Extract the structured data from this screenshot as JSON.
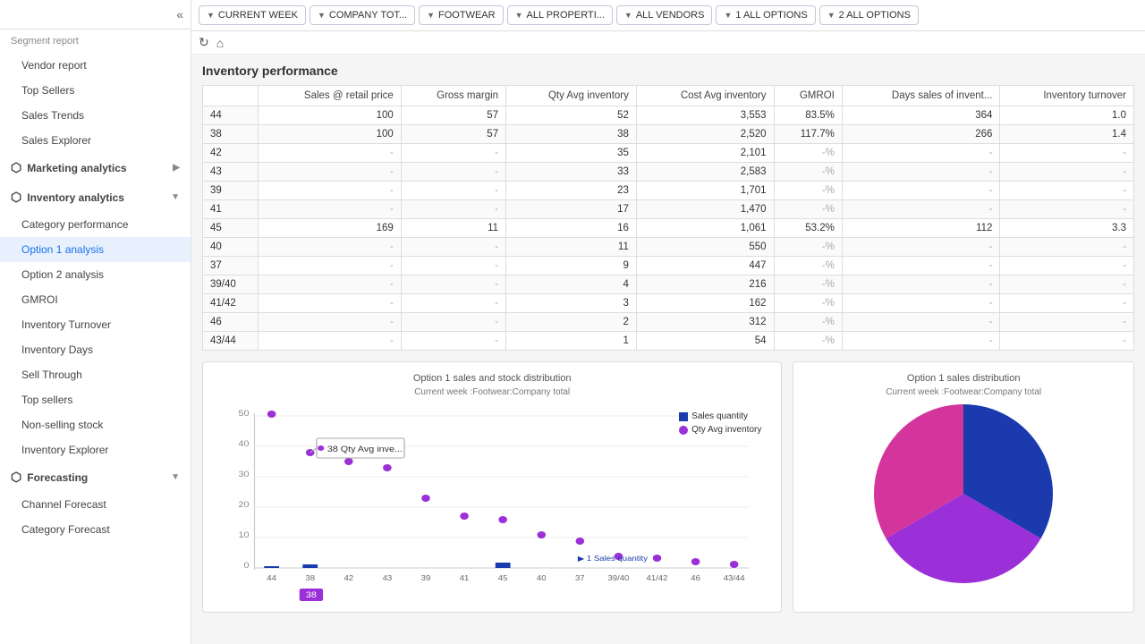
{
  "sidebar": {
    "collapse_icon": "«",
    "sections": [
      {
        "id": "marketing",
        "icon": "📊",
        "label": "Marketing analytics",
        "expanded": true,
        "items": []
      },
      {
        "id": "inventory",
        "icon": "📦",
        "label": "Inventory analytics",
        "expanded": true,
        "items": [
          {
            "id": "category-performance",
            "label": "Category performance",
            "active": false
          },
          {
            "id": "option1-analysis",
            "label": "Option 1 analysis",
            "active": true
          },
          {
            "id": "option2-analysis",
            "label": "Option 2 analysis",
            "active": false
          },
          {
            "id": "gmroi",
            "label": "GMROI",
            "active": false
          },
          {
            "id": "inventory-turnover",
            "label": "Inventory Turnover",
            "active": false
          },
          {
            "id": "inventory-days",
            "label": "Inventory Days",
            "active": false
          },
          {
            "id": "sell-through",
            "label": "Sell Through",
            "active": false
          },
          {
            "id": "top-sellers",
            "label": "Top sellers",
            "active": false
          },
          {
            "id": "non-selling-stock",
            "label": "Non-selling stock",
            "active": false
          },
          {
            "id": "inventory-explorer",
            "label": "Inventory Explorer",
            "active": false
          }
        ]
      },
      {
        "id": "forecasting",
        "icon": "📈",
        "label": "Forecasting",
        "expanded": true,
        "items": [
          {
            "id": "channel-forecast",
            "label": "Channel Forecast",
            "active": false
          },
          {
            "id": "category-forecast",
            "label": "Category Forecast",
            "active": false
          }
        ]
      }
    ]
  },
  "filters": [
    {
      "id": "week",
      "label": "CURRENT WEEK"
    },
    {
      "id": "company",
      "label": "COMPANY TOT..."
    },
    {
      "id": "footwear",
      "label": "FOOTWEAR"
    },
    {
      "id": "properties",
      "label": "ALL PROPERTI..."
    },
    {
      "id": "vendors",
      "label": "ALL VENDORS"
    },
    {
      "id": "options1",
      "label": "1 ALL OPTIONS"
    },
    {
      "id": "options2",
      "label": "2 ALL OPTIONS"
    }
  ],
  "page_title": "Inventory performance",
  "table": {
    "headers": [
      "",
      "Sales @ retail price",
      "Gross margin",
      "Qty Avg inventory",
      "Cost Avg inventory",
      "GMROI",
      "Days sales of invent...",
      "Inventory turnover"
    ],
    "rows": [
      {
        "label": "44",
        "sales": "100",
        "gross": "57",
        "qty": "52",
        "cost": "3,553",
        "gmroi": "83.5%",
        "days": "364",
        "turnover": "1.0"
      },
      {
        "label": "38",
        "sales": "100",
        "gross": "57",
        "qty": "38",
        "cost": "2,520",
        "gmroi": "117.7%",
        "days": "266",
        "turnover": "1.4"
      },
      {
        "label": "42",
        "sales": "-",
        "gross": "-",
        "qty": "35",
        "cost": "2,101",
        "gmroi": "-%",
        "days": "-",
        "turnover": "-"
      },
      {
        "label": "43",
        "sales": "-",
        "gross": "-",
        "qty": "33",
        "cost": "2,583",
        "gmroi": "-%",
        "days": "-",
        "turnover": "-"
      },
      {
        "label": "39",
        "sales": "-",
        "gross": "-",
        "qty": "23",
        "cost": "1,701",
        "gmroi": "-%",
        "days": "-",
        "turnover": "-"
      },
      {
        "label": "41",
        "sales": "-",
        "gross": "-",
        "qty": "17",
        "cost": "1,470",
        "gmroi": "-%",
        "days": "-",
        "turnover": "-"
      },
      {
        "label": "45",
        "sales": "169",
        "gross": "11",
        "qty": "16",
        "cost": "1,061",
        "gmroi": "53.2%",
        "days": "112",
        "turnover": "3.3"
      },
      {
        "label": "40",
        "sales": "-",
        "gross": "-",
        "qty": "11",
        "cost": "550",
        "gmroi": "-%",
        "days": "-",
        "turnover": "-"
      },
      {
        "label": "37",
        "sales": "-",
        "gross": "-",
        "qty": "9",
        "cost": "447",
        "gmroi": "-%",
        "days": "-",
        "turnover": "-"
      },
      {
        "label": "39/40",
        "sales": "-",
        "gross": "-",
        "qty": "4",
        "cost": "216",
        "gmroi": "-%",
        "days": "-",
        "turnover": "-"
      },
      {
        "label": "41/42",
        "sales": "-",
        "gross": "-",
        "qty": "3",
        "cost": "162",
        "gmroi": "-%",
        "days": "-",
        "turnover": "-"
      },
      {
        "label": "46",
        "sales": "-",
        "gross": "-",
        "qty": "2",
        "cost": "312",
        "gmroi": "-%",
        "days": "-",
        "turnover": "-"
      },
      {
        "label": "43/44",
        "sales": "-",
        "gross": "-",
        "qty": "1",
        "cost": "54",
        "gmroi": "-%",
        "days": "-",
        "turnover": "-"
      }
    ]
  },
  "chart1": {
    "title": "Option 1 sales and stock distribution",
    "subtitle": "Current week :Footwear:Company total",
    "legend": {
      "sales_label": "Sales quantity",
      "qty_label": "Qty Avg inventory"
    },
    "x_labels": [
      "44",
      "38",
      "42",
      "43",
      "39",
      "41",
      "45",
      "40",
      "37",
      "39/40",
      "41/42",
      "46",
      "43/44"
    ],
    "tooltip_label": "38",
    "tooltip_value": "Qty Avg inve...",
    "y_max": 50,
    "y_ticks": [
      "50",
      "40",
      "30",
      "20",
      "10",
      "0"
    ]
  },
  "chart2": {
    "title": "Option 1 sales distribution",
    "subtitle": "Current week :Footwear:Company total",
    "slices": [
      {
        "label": "33.3%",
        "color": "#1a3aad",
        "percent": 33.3
      },
      {
        "label": "33.3%",
        "color": "#9b30d9",
        "percent": 33.3
      },
      {
        "label": "33.3%",
        "color": "#d4359c",
        "percent": 33.4
      }
    ]
  },
  "colors": {
    "accent_blue": "#1a3aad",
    "accent_purple": "#9b30d9",
    "accent_pink": "#d4359c",
    "active_filter": "#e8f0fe"
  }
}
